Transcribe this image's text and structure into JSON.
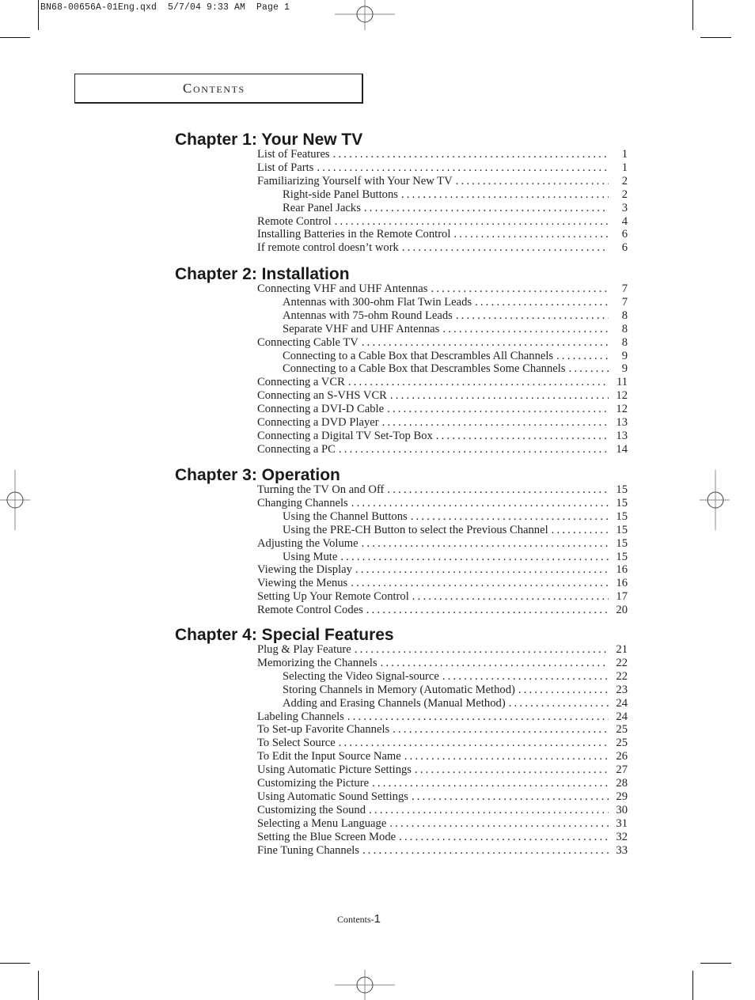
{
  "slug_line": "BN68-00656A-01Eng.qxd  5/7/04 9:33 AM  Page 1",
  "header": {
    "title": "Contents"
  },
  "chapters": [
    {
      "title": "Chapter 1: Your New TV",
      "entries": [
        {
          "title": "List of Features",
          "page": "1",
          "level": 1
        },
        {
          "title": "List of Parts",
          "page": "1",
          "level": 1
        },
        {
          "title": "Familiarizing Yourself with Your New TV",
          "page": "2",
          "level": 1
        },
        {
          "title": "Right-side Panel Buttons",
          "page": "2",
          "level": 2
        },
        {
          "title": "Rear Panel Jacks",
          "page": "3",
          "level": 2
        },
        {
          "title": "Remote Control",
          "page": "4",
          "level": 1
        },
        {
          "title": "Installing Batteries in the Remote Control",
          "page": "6",
          "level": 1
        },
        {
          "title": "If remote control doesn’t work",
          "page": "6",
          "level": 1
        }
      ]
    },
    {
      "title": "Chapter 2: Installation",
      "entries": [
        {
          "title": "Connecting VHF and UHF Antennas",
          "page": "7",
          "level": 1
        },
        {
          "title": "Antennas with 300-ohm Flat Twin Leads",
          "page": "7",
          "level": 2
        },
        {
          "title": "Antennas with 75-ohm Round Leads",
          "page": "8",
          "level": 2
        },
        {
          "title": "Separate VHF and UHF Antennas",
          "page": "8",
          "level": 2
        },
        {
          "title": "Connecting Cable TV",
          "page": "8",
          "level": 1
        },
        {
          "title": "Connecting to a Cable Box that Descrambles All Channels",
          "page": "9",
          "level": 2
        },
        {
          "title": "Connecting to a Cable Box that Descrambles Some Channels",
          "page": "9",
          "level": 2
        },
        {
          "title": "Connecting a VCR",
          "page": "11",
          "level": 1
        },
        {
          "title": "Connecting an S-VHS VCR",
          "page": "12",
          "level": 1
        },
        {
          "title": "Connecting a DVI-D Cable",
          "page": "12",
          "level": 1
        },
        {
          "title": "Connecting a DVD Player",
          "page": "13",
          "level": 1
        },
        {
          "title": "Connecting a Digital TV Set-Top Box",
          "page": "13",
          "level": 1
        },
        {
          "title": "Connecting a PC",
          "page": "14",
          "level": 1
        }
      ]
    },
    {
      "title": "Chapter 3: Operation",
      "entries": [
        {
          "title": "Turning the TV On and Off",
          "page": "15",
          "level": 1
        },
        {
          "title": "Changing Channels",
          "page": "15",
          "level": 1
        },
        {
          "title": "Using the Channel Buttons",
          "page": "15",
          "level": 2
        },
        {
          "title": "Using the PRE-CH Button to select the Previous Channel",
          "page": "15",
          "level": 2
        },
        {
          "title": "Adjusting the Volume",
          "page": "15",
          "level": 1
        },
        {
          "title": "Using Mute",
          "page": "15",
          "level": 2
        },
        {
          "title": "Viewing the Display",
          "page": "16",
          "level": 1
        },
        {
          "title": "Viewing the Menus",
          "page": "16",
          "level": 1
        },
        {
          "title": "Setting Up Your Remote Control",
          "page": "17",
          "level": 1
        },
        {
          "title": "Remote Control Codes",
          "page": "20",
          "level": 1
        }
      ]
    },
    {
      "title": "Chapter 4: Special Features",
      "entries": [
        {
          "title": "Plug & Play Feature",
          "page": "21",
          "level": 1
        },
        {
          "title": "Memorizing the Channels",
          "page": "22",
          "level": 1
        },
        {
          "title": "Selecting the Video Signal-source",
          "page": "22",
          "level": 2
        },
        {
          "title": "Storing Channels in Memory (Automatic Method)",
          "page": "23",
          "level": 2
        },
        {
          "title": "Adding and Erasing Channels (Manual Method)",
          "page": "24",
          "level": 2
        },
        {
          "title": "Labeling Channels",
          "page": "24",
          "level": 1
        },
        {
          "title": "To Set-up Favorite Channels",
          "page": "25",
          "level": 1
        },
        {
          "title": "To Select Source",
          "page": "25",
          "level": 1
        },
        {
          "title": "To Edit the Input Source Name",
          "page": "26",
          "level": 1
        },
        {
          "title": "Using Automatic Picture Settings",
          "page": "27",
          "level": 1
        },
        {
          "title": "Customizing the Picture",
          "page": "28",
          "level": 1
        },
        {
          "title": "Using Automatic Sound Settings",
          "page": "29",
          "level": 1
        },
        {
          "title": "Customizing the Sound",
          "page": "30",
          "level": 1
        },
        {
          "title": "Selecting a Menu Language",
          "page": "31",
          "level": 1
        },
        {
          "title": "Setting the Blue Screen Mode",
          "page": "32",
          "level": 1
        },
        {
          "title": "Fine Tuning Channels",
          "page": "33",
          "level": 1
        }
      ]
    }
  ],
  "footer": {
    "label": "Contents-",
    "page_number": "1"
  }
}
